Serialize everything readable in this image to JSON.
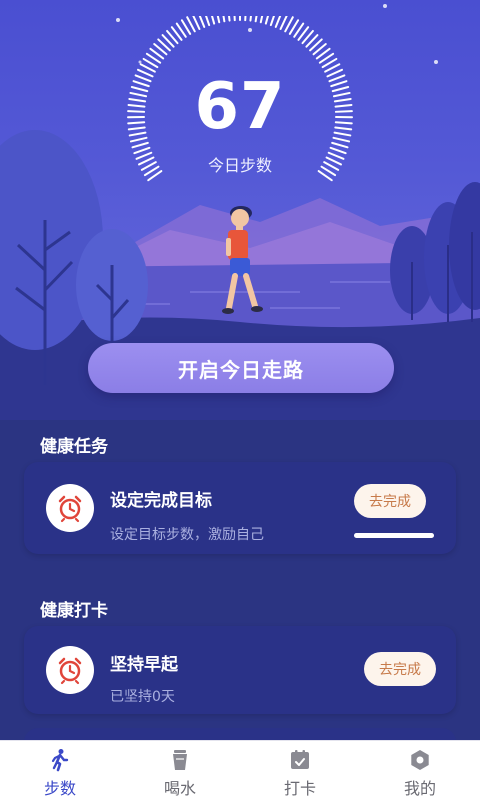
{
  "hero": {
    "steps": "67",
    "steps_label": "今日步数",
    "start_button": "开启今日走路"
  },
  "tasks": {
    "title": "健康任务",
    "items": [
      {
        "title": "设定完成目标",
        "subtitle": "设定目标步数，激励自己",
        "action": "去完成",
        "icon": "alarm-clock-icon",
        "progress": 1.0
      }
    ]
  },
  "checkin": {
    "title": "健康打卡",
    "items": [
      {
        "title": "坚持早起",
        "subtitle": "已坚持0天",
        "action": "去完成",
        "icon": "alarm-clock-icon"
      }
    ]
  },
  "nav": {
    "items": [
      {
        "label": "步数",
        "icon": "walking-icon",
        "active": true
      },
      {
        "label": "喝水",
        "icon": "cup-icon",
        "active": false
      },
      {
        "label": "打卡",
        "icon": "calendar-check-icon",
        "active": false
      },
      {
        "label": "我的",
        "icon": "profile-icon",
        "active": false
      }
    ]
  },
  "colors": {
    "background": "#2b3482",
    "card": "#2a3288",
    "accent": "#3b49c8",
    "button": "#9c8ff0",
    "pill_text": "#c77a4a",
    "icon_red": "#e0453a"
  }
}
